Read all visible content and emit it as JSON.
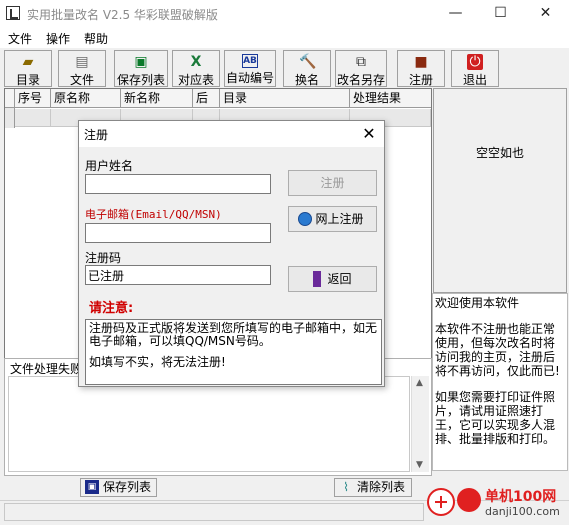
{
  "window": {
    "title": "实用批量改名 V2.5 华彩联盟破解版",
    "minimize": "—",
    "maximize": "☐",
    "close": "✕"
  },
  "menu": [
    "文件",
    "操作",
    "帮助"
  ],
  "toolbar": [
    "目录",
    "文件",
    "保存列表",
    "对应表",
    "自动编号",
    "换名",
    "改名另存",
    "注册",
    "退出"
  ],
  "grid": {
    "columns": [
      "序号",
      "原名称",
      "新名称",
      "后缀",
      "目录",
      "处理结果"
    ]
  },
  "right_panel": {
    "title": "空空如也",
    "welcome": "欢迎使用本软件",
    "para1": "本软件不注册也能正常使用，但每次改名时将访问我的主页，注册后将不再访问，仅此而已!",
    "para2": "如果您需要打印证件照片，请试用证照速打王，它可以实现多人混排、批量排版和打印。"
  },
  "fail_section": {
    "label": "文件处理失败"
  },
  "bottom_buttons": {
    "save_list": "保存列表",
    "clear_list": "清除列表"
  },
  "dialog": {
    "title": "注册",
    "username_label": "用户姓名",
    "username_value": "",
    "email_label": "电子邮箱(Email/QQ/MSN)",
    "email_value": "",
    "code_label": "注册码",
    "code_value": "已注册",
    "register_button": "注册",
    "online_register_button": "网上注册",
    "back_button": "返回",
    "notice_title": "请注意:",
    "notice_p1": "注册码及正式版将发送到您所填写的电子邮箱中，如无电子邮箱，可以填QQ/MSN号码。",
    "notice_p2": "如填写不实，将无法注册!"
  },
  "watermark": {
    "site_name": "单机100网",
    "site_url": "danji100.com"
  },
  "colors": {
    "accent_red": "#d00000",
    "label_red": "#c00000",
    "watermark_red": "#e02020"
  }
}
